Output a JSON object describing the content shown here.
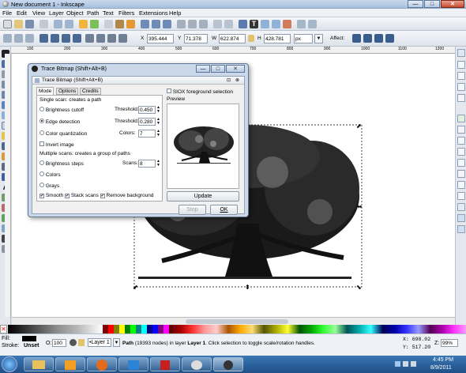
{
  "window": {
    "title": "New document 1 - Inkscape",
    "min": "—",
    "max": "□",
    "close": "✕"
  },
  "menu": [
    "File",
    "Edit",
    "View",
    "Layer",
    "Object",
    "Path",
    "Text",
    "Filters",
    "Extensions",
    "Help"
  ],
  "toolbar": {
    "x_label": "X",
    "x_value": "395.444",
    "y_label": "Y",
    "y_value": "71.378",
    "w_label": "W",
    "w_value": "622.874",
    "h_label": "H",
    "h_value": "428.781",
    "unit": "px",
    "affect_label": "Affect:"
  },
  "ruler_ticks": [
    "100",
    "200",
    "300",
    "400",
    "500",
    "600",
    "700",
    "800",
    "900",
    "1000",
    "1100",
    "1200"
  ],
  "dialog": {
    "outer_title": "Trace Bitmap (Shift+Alt+B)",
    "inner_title": "Trace Bitmap (Shift+Alt+B)",
    "tabs": [
      "Mode",
      "Options",
      "Credits"
    ],
    "siox": "SIOX foreground selection",
    "single_scan": "Single scan: creates a path",
    "brightness_cutoff": "Brightness cutoff",
    "threshold_label": "Threshold:",
    "brightness_threshold": "0.450",
    "edge_detection": "Edge detection",
    "edge_threshold": "0.280",
    "color_quant": "Color quantization",
    "colors_label": "Colors:",
    "colors_value": "7",
    "invert": "Invert image",
    "multi_scan": "Multiple scans: creates a group of paths",
    "brightness_steps": "Brightness steps",
    "scans_label": "Scans:",
    "scans_value": "8",
    "colors_opt": "Colors",
    "grays_opt": "Grays",
    "smooth": "Smooth",
    "stack": "Stack scans",
    "remove_bg": "Remove background",
    "preview": "Preview",
    "update": "Update",
    "stop": "Stop",
    "ok": "OK"
  },
  "status": {
    "fill_label": "Fill:",
    "stroke_label": "Stroke:",
    "stroke_value": "Unset",
    "opacity_label": "O:",
    "opacity_value": "100",
    "layer": "•Layer 1",
    "message_bold": "Path",
    "message": " (19393 nodes) in layer ",
    "message_layer": "Layer 1",
    "message_tail": ". Click selection to toggle scale/rotation handles.",
    "x_coord": "X: 698.02",
    "y_coord": "Y: 517.20",
    "zoom_label": "Z:",
    "zoom_value": "99%"
  },
  "taskbar": {
    "time": "4:45 PM",
    "date": "8/9/2011"
  },
  "colors": {
    "accent": "#3a78b4",
    "dialog_frame": "#cbd8e9"
  }
}
